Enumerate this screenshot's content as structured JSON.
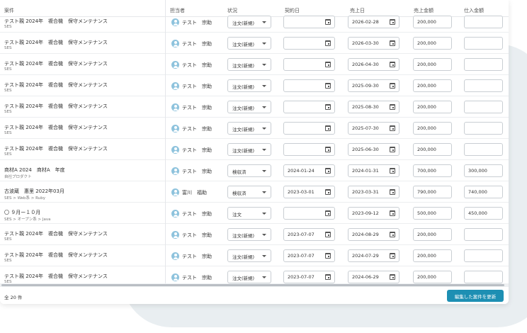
{
  "columns": {
    "case": "案件",
    "assignee": "担当者",
    "status": "状況",
    "contract_date": "契約日",
    "sales_date": "売上日",
    "sales_amount": "売上金額",
    "purchase_amount": "仕入金額"
  },
  "rows": [
    {
      "title": "テスト親 2024年　複合機　保守メンテナンス",
      "sub": "SES",
      "assignee": "テスト　宗助",
      "status": "注文(新規)",
      "contract_date": "",
      "sales_date": "2026-02-28",
      "sales_amount": "200,000",
      "purchase_amount": ""
    },
    {
      "title": "テスト親 2024年　複合機　保守メンテナンス",
      "sub": "SES",
      "assignee": "テスト　宗助",
      "status": "注文(新規)",
      "contract_date": "",
      "sales_date": "2026-03-30",
      "sales_amount": "200,000",
      "purchase_amount": ""
    },
    {
      "title": "テスト親 2024年　複合機　保守メンテナンス",
      "sub": "SES",
      "assignee": "テスト　宗助",
      "status": "注文(新規)",
      "contract_date": "",
      "sales_date": "2026-04-30",
      "sales_amount": "200,000",
      "purchase_amount": ""
    },
    {
      "title": "テスト親 2024年　複合機　保守メンテナンス",
      "sub": "SES",
      "assignee": "テスト　宗助",
      "status": "注文(新規)",
      "contract_date": "",
      "sales_date": "2025-09-30",
      "sales_amount": "200,000",
      "purchase_amount": ""
    },
    {
      "title": "テスト親 2024年　複合機　保守メンテナンス",
      "sub": "SES",
      "assignee": "テスト　宗助",
      "status": "注文(新規)",
      "contract_date": "",
      "sales_date": "2025-08-30",
      "sales_amount": "200,000",
      "purchase_amount": ""
    },
    {
      "title": "テスト親 2024年　複合機　保守メンテナンス",
      "sub": "SES",
      "assignee": "テスト　宗助",
      "status": "注文(新規)",
      "contract_date": "",
      "sales_date": "2025-07-30",
      "sales_amount": "200,000",
      "purchase_amount": ""
    },
    {
      "title": "テスト親 2024年　複合機　保守メンテナンス",
      "sub": "SES",
      "assignee": "テスト　宗助",
      "status": "注文(新規)",
      "contract_date": "",
      "sales_date": "2025-06-30",
      "sales_amount": "200,000",
      "purchase_amount": ""
    },
    {
      "title": "商材A 2024　商材A　年度",
      "sub": "自社プロダクト",
      "assignee": "テスト　宗助",
      "status": "検収済",
      "contract_date": "2024-01-24",
      "sales_date": "2024-01-31",
      "sales_amount": "700,000",
      "purchase_amount": "300,000"
    },
    {
      "title": "古波蔵　惠里 2022年03月",
      "sub": "SES > Web系 > Ruby",
      "assignee": "富川　福助",
      "status": "検収済",
      "contract_date": "2023-03-01",
      "sales_date": "2023-03-31",
      "sales_amount": "790,000",
      "purchase_amount": "740,000"
    },
    {
      "title": "〇 ９月ー１０月",
      "sub": "SES > オープン系 > Java",
      "assignee": "テスト　宗助",
      "status": "注文",
      "contract_date": "",
      "sales_date": "2023-09-12",
      "sales_amount": "500,000",
      "purchase_amount": "450,000"
    },
    {
      "title": "テスト親 2024年　複合機　保守メンテナンス",
      "sub": "SES",
      "assignee": "テスト　宗助",
      "status": "注文(新規)",
      "contract_date": "2023-07-07",
      "sales_date": "2024-08-29",
      "sales_amount": "200,000",
      "purchase_amount": ""
    },
    {
      "title": "テスト親 2024年　複合機　保守メンテナンス",
      "sub": "SES",
      "assignee": "テスト　宗助",
      "status": "注文(新規)",
      "contract_date": "2023-07-07",
      "sales_date": "2024-07-29",
      "sales_amount": "200,000",
      "purchase_amount": ""
    },
    {
      "title": "テスト親 2024年　複合機　保守メンテナンス",
      "sub": "SES",
      "assignee": "テスト　宗助",
      "status": "注文(新規)",
      "contract_date": "2023-07-07",
      "sales_date": "2024-06-29",
      "sales_amount": "200,000",
      "purchase_amount": ""
    }
  ],
  "footer": {
    "total": "全 20 件",
    "update_button": "編集した案件を更新"
  },
  "colors": {
    "accent": "#1d8fb3",
    "avatar": "#8ec3dd"
  },
  "icons": {
    "avatar": "user-avatar-icon",
    "calendar": "calendar-icon",
    "dropdown": "chevron-down-icon"
  }
}
